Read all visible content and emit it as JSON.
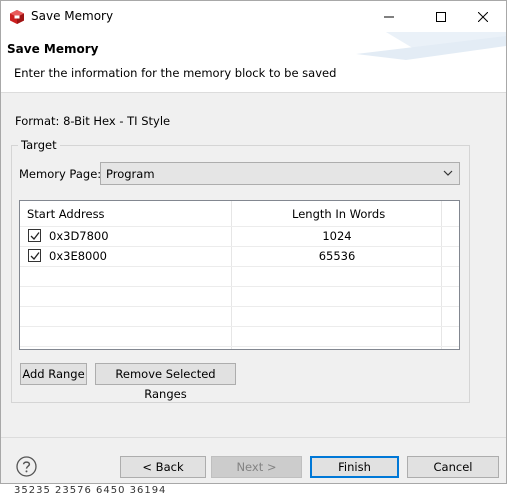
{
  "window": {
    "title": "Save Memory"
  },
  "header": {
    "title": "Save Memory",
    "message": "Enter the information for the memory block to be saved"
  },
  "format": {
    "label": "Format:",
    "value": "8-Bit Hex - TI Style"
  },
  "target": {
    "group_title": "Target",
    "memory_page_label": "Memory Page:",
    "memory_page_value": "Program",
    "table": {
      "columns": [
        "Start Address",
        "Length In Words"
      ],
      "rows": [
        {
          "checked": true,
          "start_address": "0x3D7800",
          "length": "1024"
        },
        {
          "checked": true,
          "start_address": "0x3E8000",
          "length": "65536"
        }
      ]
    },
    "add_range_label": "Add Range",
    "remove_ranges_label": "Remove Selected Ranges"
  },
  "footer": {
    "back_label": "< Back",
    "next_label": "Next >",
    "finish_label": "Finish",
    "cancel_label": "Cancel"
  },
  "background_peek": "35235  23576  6450  36194"
}
